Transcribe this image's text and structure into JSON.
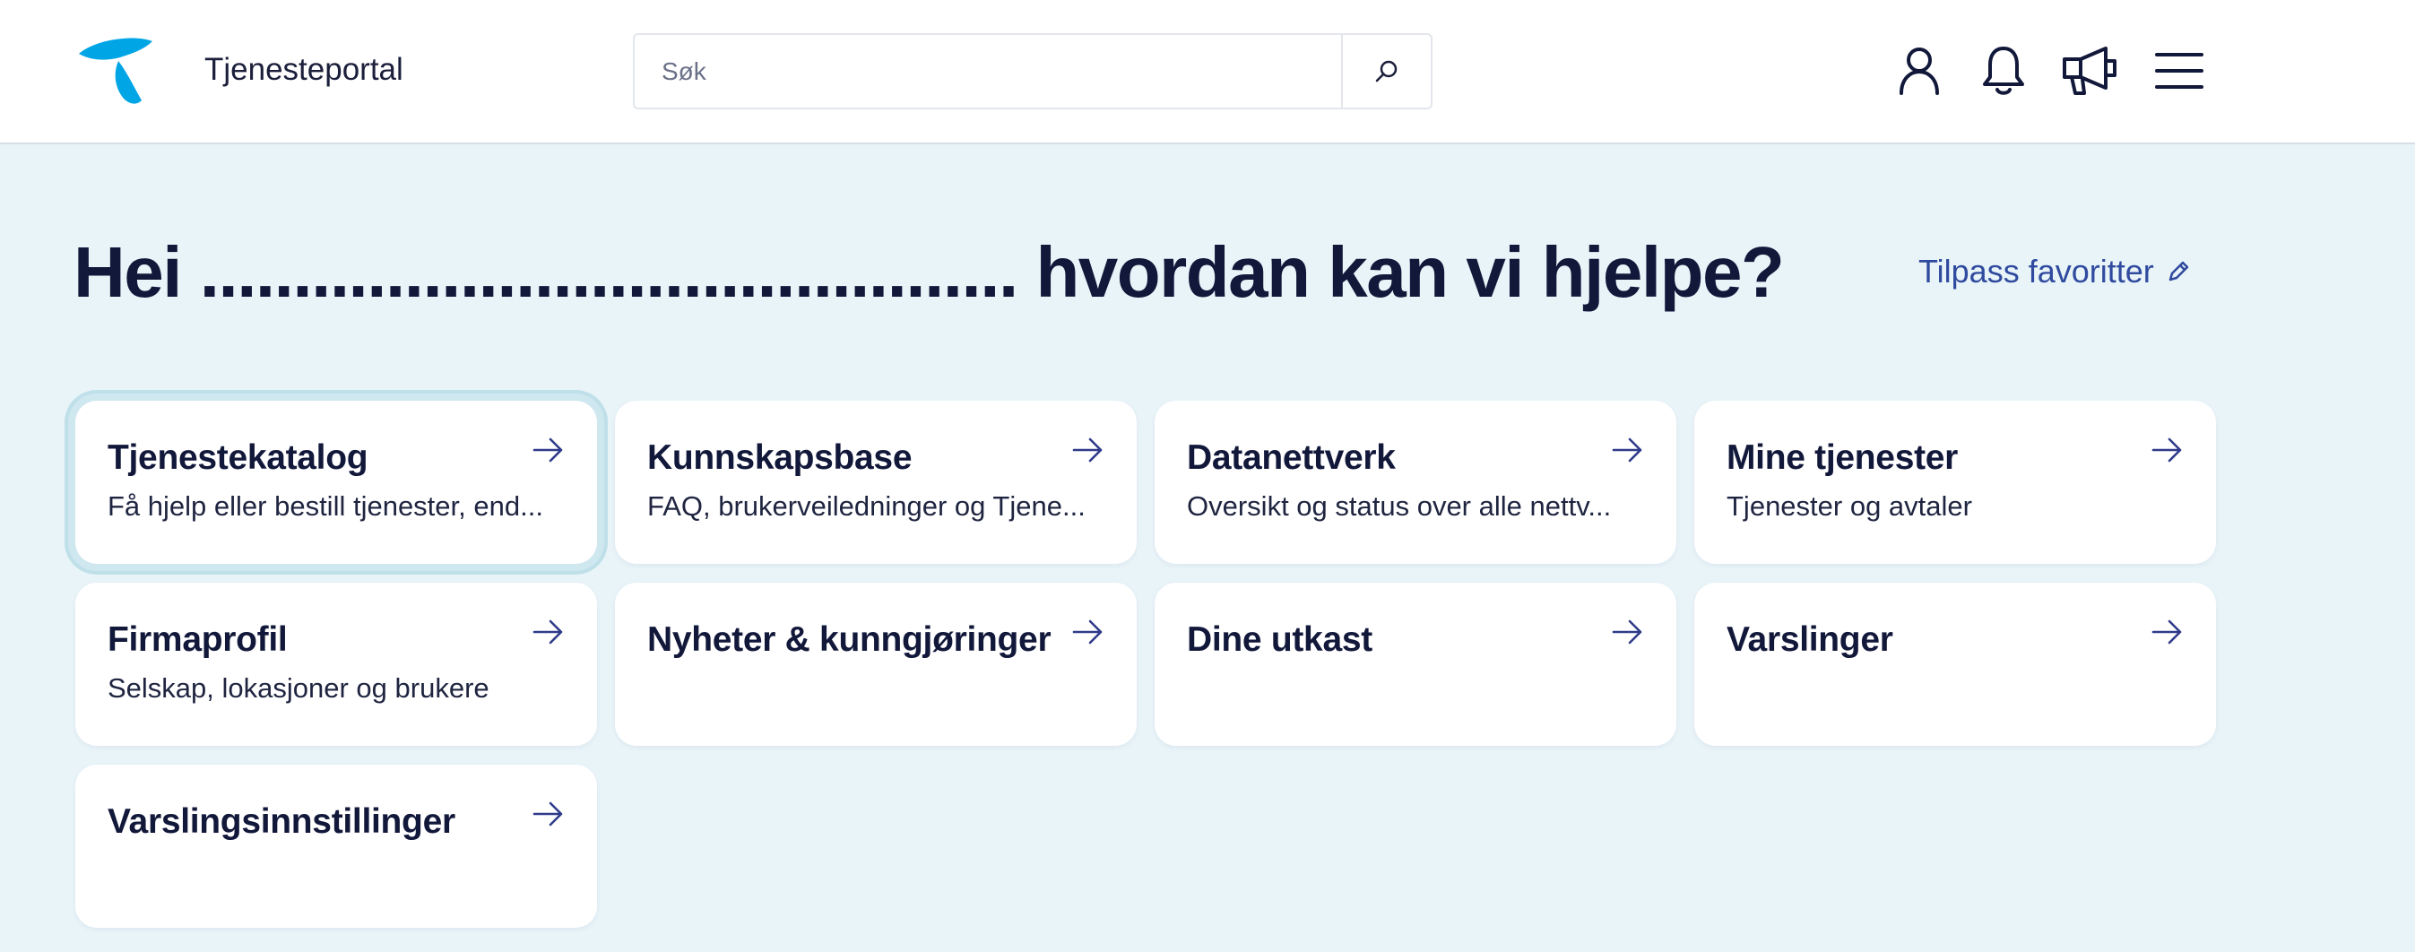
{
  "header": {
    "title": "Tjenesteportal",
    "search_placeholder": "Søk",
    "icons": [
      "user-icon",
      "bell-icon",
      "megaphone-icon",
      "menu-icon"
    ]
  },
  "hero": {
    "greeting_start": "Hei",
    "greeting_name": "............................................",
    "greeting_end": "hvordan kan vi hjelpe?",
    "customize_label": "Tilpass favoritter"
  },
  "colors": {
    "brand": "#00a5e5",
    "accent": "#2f4a9e",
    "background": "#e9f4f9",
    "text": "#12183a"
  },
  "cards": [
    {
      "title": "Tjenestekatalog",
      "subtitle": "Få hjelp eller bestill tjenester, end..."
    },
    {
      "title": "Kunnskapsbase",
      "subtitle": "FAQ, brukerveiledninger og Tjene..."
    },
    {
      "title": "Datanettverk",
      "subtitle": "Oversikt og status over alle nettv..."
    },
    {
      "title": "Mine tjenester",
      "subtitle": "Tjenester og avtaler"
    },
    {
      "title": "Firmaprofil",
      "subtitle": "Selskap, lokasjoner og brukere"
    },
    {
      "title": "Nyheter & kunngjøringer",
      "subtitle": ""
    },
    {
      "title": "Dine utkast",
      "subtitle": ""
    },
    {
      "title": "Varslinger",
      "subtitle": ""
    },
    {
      "title": "Varslingsinnstillinger",
      "subtitle": ""
    }
  ]
}
